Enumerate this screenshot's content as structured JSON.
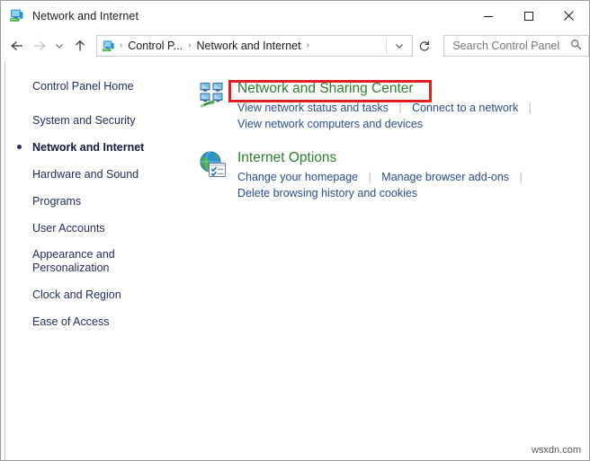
{
  "window": {
    "title": "Network and Internet",
    "title_icon": "network-computer-icon",
    "minimize_label": "Minimize",
    "maximize_label": "Maximize",
    "close_label": "Close"
  },
  "nav": {
    "back_label": "Back",
    "forward_label": "Forward",
    "recent_label": "Recent locations",
    "up_label": "Up one level",
    "refresh_label": "Refresh",
    "breadcrumb": {
      "icon": "control-panel-icon",
      "items": [
        "Control P...",
        "Network and Internet"
      ],
      "separator": "›",
      "trailing_separator": "›"
    }
  },
  "search": {
    "placeholder": "Search Control Panel",
    "value": "",
    "icon": "search-icon"
  },
  "sidebar": {
    "items": [
      {
        "label": "Control Panel Home",
        "current": false,
        "gap_after": true
      },
      {
        "label": "System and Security",
        "current": false
      },
      {
        "label": "Network and Internet",
        "current": true
      },
      {
        "label": "Hardware and Sound",
        "current": false
      },
      {
        "label": "Programs",
        "current": false
      },
      {
        "label": "User Accounts",
        "current": false
      },
      {
        "label": "Appearance and Personalization",
        "current": false
      },
      {
        "label": "Clock and Region",
        "current": false
      },
      {
        "label": "Ease of Access",
        "current": false
      }
    ]
  },
  "main": {
    "categories": [
      {
        "icon": "network-sharing-center-icon",
        "title": "Network and Sharing Center",
        "title_color": "#2f7d32",
        "highlighted": true,
        "links_row1": [
          "View network status and tasks",
          "Connect to a network"
        ],
        "row1_trailing_separator": true,
        "links_row2": [
          "View network computers and devices"
        ]
      },
      {
        "icon": "internet-options-icon",
        "title": "Internet Options",
        "title_color": "#2f7d32",
        "highlighted": false,
        "links_row1": [
          "Change your homepage",
          "Manage browser add-ons"
        ],
        "row1_trailing_separator": true,
        "links_row2": [
          "Delete browsing history and cookies"
        ]
      }
    ]
  },
  "annotation": {
    "color": "#e02020",
    "target": "Network and Sharing Center"
  },
  "watermark": {
    "text": "wsxdn.com"
  }
}
